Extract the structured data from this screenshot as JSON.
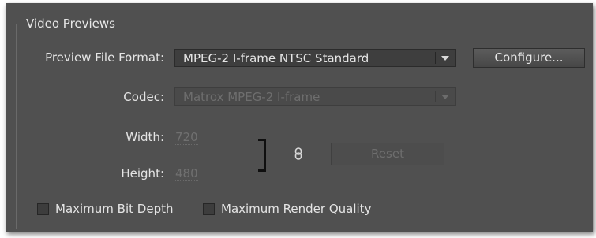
{
  "group": {
    "title": "Video Previews"
  },
  "preview_format": {
    "label": "Preview File Format:",
    "value": "MPEG-2 I-frame NTSC Standard"
  },
  "configure": {
    "label": "Configure..."
  },
  "codec": {
    "label": "Codec:",
    "value": "Matrox MPEG-2 I-frame",
    "enabled": false
  },
  "width": {
    "label": "Width:",
    "value": "720"
  },
  "height": {
    "label": "Height:",
    "value": "480"
  },
  "link_icon": "chain-link-icon",
  "reset": {
    "label": "Reset",
    "enabled": false
  },
  "options": {
    "max_bit_depth": {
      "label": "Maximum Bit Depth",
      "checked": false
    },
    "max_render_quality": {
      "label": "Maximum Render Quality",
      "checked": false
    }
  },
  "colors": {
    "panel": "#505050",
    "field": "#3e3e3e",
    "text": "#e4e4e4",
    "disabled_text": "#6e6e6e"
  }
}
